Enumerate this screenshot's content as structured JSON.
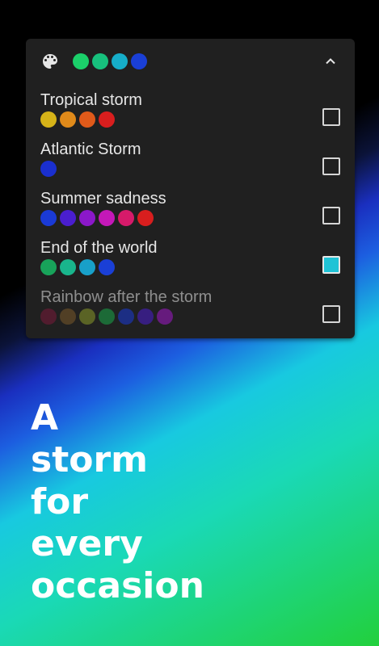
{
  "header": {
    "palette_icon": "palette-icon",
    "chevron_icon": "chevron-up-icon",
    "dots": [
      "#1bd06a",
      "#17c17d",
      "#16aec9",
      "#1a3fd6"
    ]
  },
  "storms": [
    {
      "label": "Tropical storm",
      "dots": [
        "#d6b318",
        "#e08a1a",
        "#e05a1a",
        "#d81e1e"
      ],
      "checked": false
    },
    {
      "label": "Atlantic Storm",
      "dots": [
        "#1a2fcf"
      ],
      "checked": false
    },
    {
      "label": "Summer sadness",
      "dots": [
        "#1a3ad6",
        "#4a1ecf",
        "#8b18c9",
        "#c418b8",
        "#d61a6a",
        "#d81e1e"
      ],
      "checked": false
    },
    {
      "label": "End of the world",
      "dots": [
        "#18a35a",
        "#19b58c",
        "#18a0c9",
        "#1a3fd6"
      ],
      "checked": true
    },
    {
      "label": "Rainbow after the storm",
      "dots": [
        "#7a1a3a",
        "#7a5a2a",
        "#8a9a2a",
        "#1aa84a",
        "#1a3ad6",
        "#4a1ecf",
        "#a018c9"
      ],
      "checked": false
    }
  ],
  "headline": [
    "A",
    "storm",
    "for",
    "every",
    "occasion"
  ],
  "colors": {
    "card_bg": "#202020",
    "checkbox_checked": "#1fc3d6",
    "text": "#e6e6e6"
  }
}
